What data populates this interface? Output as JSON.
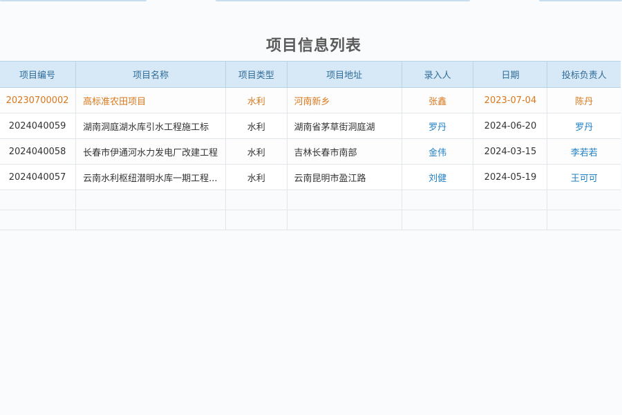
{
  "page": {
    "title": "项目信息列表"
  },
  "table": {
    "columns": [
      "项目编号",
      "项目名称",
      "项目类型",
      "项目地址",
      "录入人",
      "日期",
      "投标负责人"
    ],
    "rows": [
      {
        "id": "20230700002",
        "name": "高标准农田项目",
        "type": "水利",
        "address": "河南新乡",
        "entered_by": "张鑫",
        "date": "2023-07-04",
        "bid_lead": "陈丹",
        "selected": true
      },
      {
        "id": "2024040059",
        "name": "湖南洞庭湖水库引水工程施工标",
        "type": "水利",
        "address": "湖南省茅草街洞庭湖",
        "entered_by": "罗丹",
        "date": "2024-06-20",
        "bid_lead": "罗丹"
      },
      {
        "id": "2024040058",
        "name": "长春市伊通河水力发电厂改建工程",
        "type": "水利",
        "address": "吉林长春市南部",
        "entered_by": "金伟",
        "date": "2024-03-15",
        "bid_lead": "李若若"
      },
      {
        "id": "2024040057",
        "name": "云南水利枢纽潜明水库一期工程...",
        "type": "水利",
        "address": "云南昆明市盈江路",
        "entered_by": "刘健",
        "date": "2024-05-19",
        "bid_lead": "王可可"
      }
    ]
  },
  "colors": {
    "header_bg": "#d7e9f7",
    "header_text": "#2f6c98",
    "selected_bg": "#e3f1fc",
    "selected_text": "#d9781c",
    "link_text": "#1f7fc4"
  }
}
